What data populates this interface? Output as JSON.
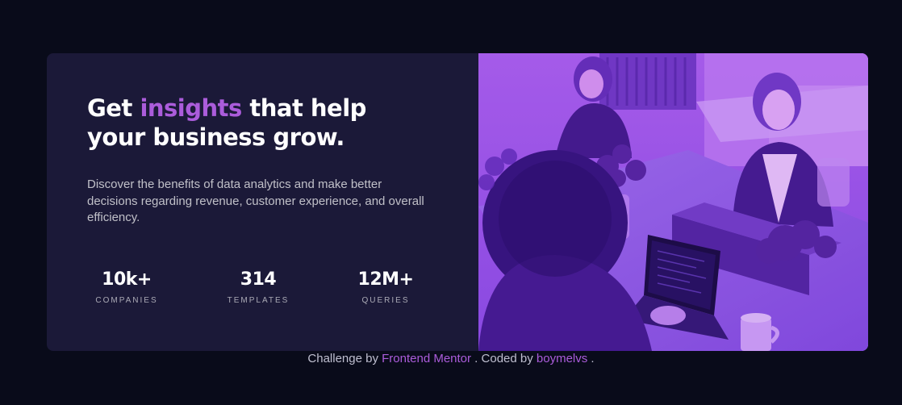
{
  "headline": {
    "before": "Get ",
    "accent": "insights",
    "after": " that help your business grow."
  },
  "description": "Discover the benefits of data analytics and make better decisions regarding revenue, customer experience, and overall efficiency.",
  "stats": [
    {
      "value": "10k+",
      "label": "COMPANIES"
    },
    {
      "value": "314",
      "label": "TEMPLATES"
    },
    {
      "value": "12M+",
      "label": "QUERIES"
    }
  ],
  "footer": {
    "prefix": "Challenge by ",
    "challenge_link": "Frontend Mentor",
    "middle": " . Coded by ",
    "author_link": "boymelvs",
    "suffix": " ."
  },
  "colors": {
    "page_bg": "#090b1a",
    "card_bg": "#1b1938",
    "accent": "#ab5cdb",
    "image_tint": "#8d4ee6"
  },
  "image": {
    "icon": "office-photo-image",
    "alt": "Women working at laptops in an office"
  }
}
